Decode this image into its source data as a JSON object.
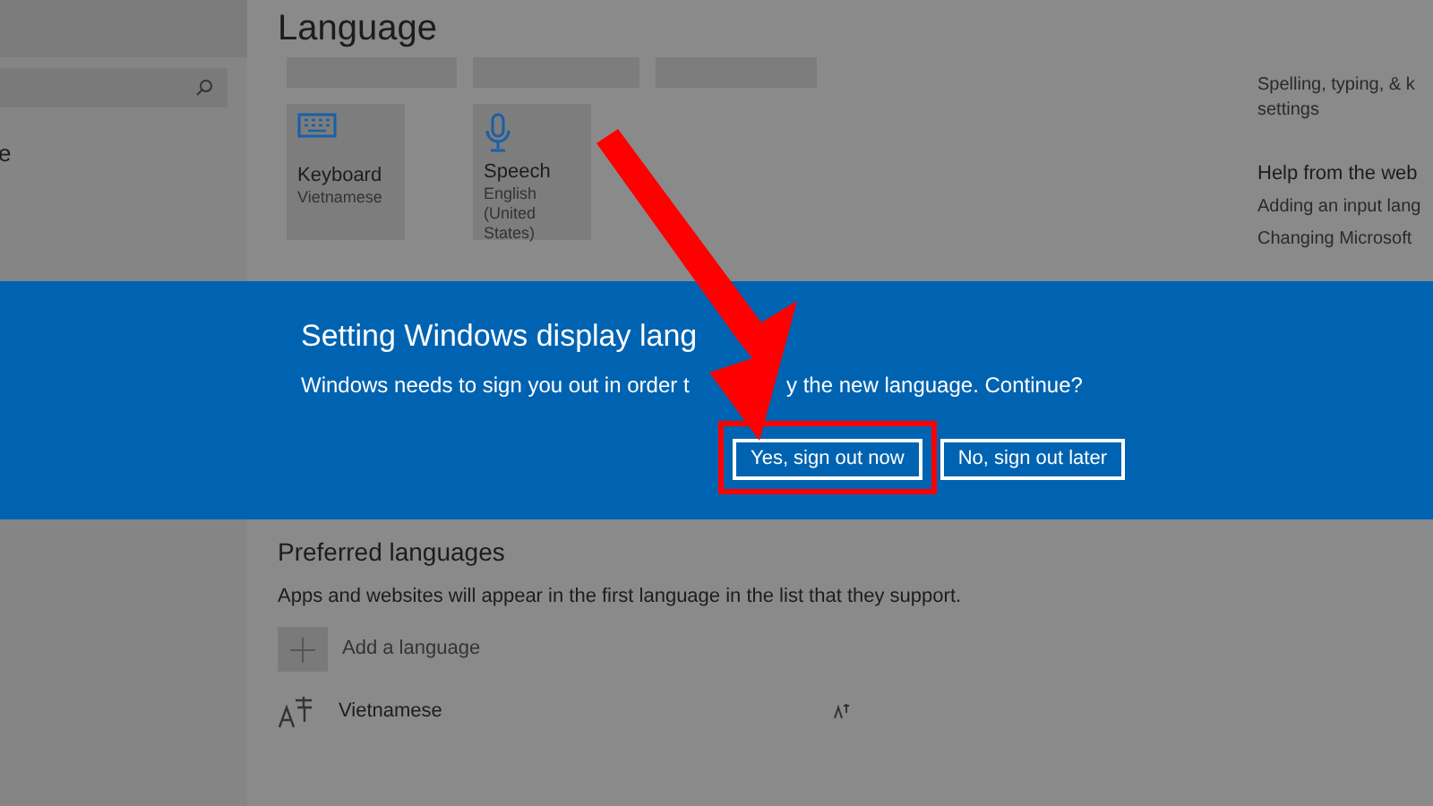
{
  "sidebar": {
    "partial_item": "e"
  },
  "page": {
    "title": "Language",
    "tiles": [
      {
        "kind": "keyboard",
        "title": "Keyboard",
        "subtitle": "Vietnamese"
      },
      {
        "kind": "speech",
        "title": "Speech",
        "subtitle": "English (United States)"
      }
    ],
    "related": {
      "link_lines": [
        "Spelling, typing, & k",
        "settings"
      ],
      "help_title": "Help from the web",
      "help_links": [
        "Adding an input lang",
        "Changing Microsoft"
      ]
    },
    "preferred": {
      "title": "Preferred languages",
      "description": "Apps and websites will appear in the first language in the list that they support.",
      "add_label": "Add a language",
      "languages": [
        "Vietnamese"
      ]
    }
  },
  "dialog": {
    "title": "Setting Windows display lang",
    "message_parts": [
      "Windows needs to sign you out in order t",
      "y the new language. Continue?"
    ],
    "buttons": [
      {
        "label": "Yes, sign out now",
        "highlighted": true
      },
      {
        "label": "No, sign out later",
        "highlighted": false
      }
    ]
  }
}
